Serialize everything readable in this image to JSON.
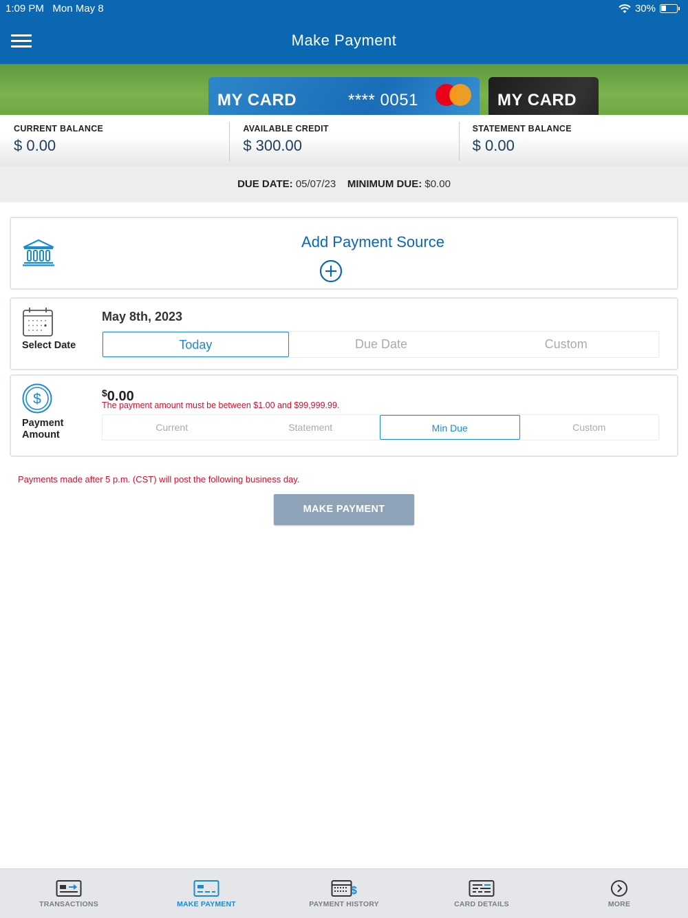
{
  "status_bar": {
    "time": "1:09 PM",
    "date": "Mon May 8",
    "battery": "30%"
  },
  "header": {
    "title": "Make Payment"
  },
  "cards": [
    {
      "name": "MY CARD",
      "number": "**** 0051"
    },
    {
      "name": "MY CARD"
    }
  ],
  "balances": {
    "current_label": "CURRENT BALANCE",
    "current_value": "$ 0.00",
    "available_label": "AVAILABLE CREDIT",
    "available_value": "$ 300.00",
    "statement_label": "STATEMENT BALANCE",
    "statement_value": "$ 0.00"
  },
  "due": {
    "due_date_label": "DUE DATE:",
    "due_date": "05/07/23",
    "min_due_label": "MINIMUM DUE:",
    "min_due": "$0.00"
  },
  "payment_source": {
    "title": "Add Payment Source"
  },
  "select_date": {
    "label": "Select Date",
    "value": "May 8th, 2023",
    "options": [
      "Today",
      "Due Date",
      "Custom"
    ],
    "selected": "Today"
  },
  "payment_amount": {
    "label_line1": "Payment",
    "label_line2": "Amount",
    "currency": "$",
    "value": "0.00",
    "error": "The payment amount must be between $1.00 and $99,999.99.",
    "options": [
      "Current",
      "Statement",
      "Min Due",
      "Custom"
    ],
    "selected": "Min Due"
  },
  "notice": "Payments made after 5 p.m. (CST) will post the following business day.",
  "make_payment_button": "MAKE PAYMENT",
  "tabs": [
    {
      "label": "TRANSACTIONS",
      "icon": "transactions-icon"
    },
    {
      "label": "MAKE PAYMENT",
      "icon": "make-payment-icon",
      "active": true
    },
    {
      "label": "PAYMENT HISTORY",
      "icon": "payment-history-icon"
    },
    {
      "label": "CARD DETAILS",
      "icon": "card-details-icon"
    },
    {
      "label": "MORE",
      "icon": "more-icon"
    }
  ],
  "colors": {
    "brand_blue": "#0b67b2",
    "accent": "#1b8ad0",
    "error": "#d0102d",
    "button": "#8ea3b7"
  }
}
